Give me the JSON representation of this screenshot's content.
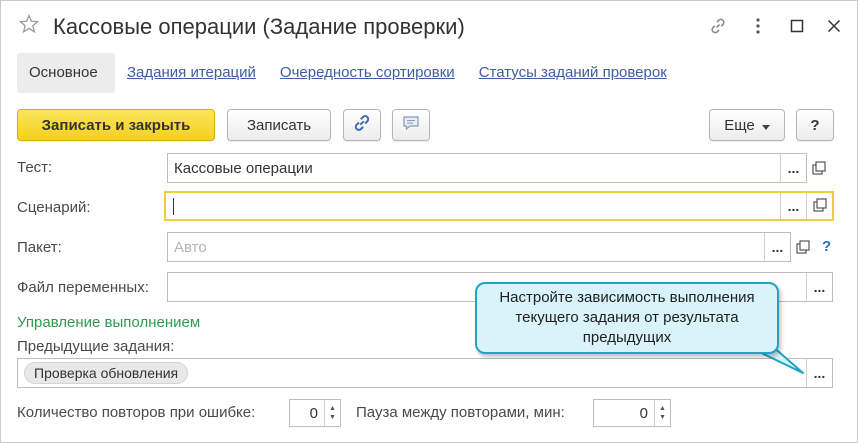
{
  "window": {
    "title": "Кассовые операции (Задание проверки)"
  },
  "tabs": [
    {
      "label": "Основное",
      "active": true
    },
    {
      "label": "Задания итераций"
    },
    {
      "label": "Очередность сортировки"
    },
    {
      "label": "Статусы заданий проверок"
    }
  ],
  "toolbar": {
    "save_close_label": "Записать и закрыть",
    "save_label": "Записать",
    "more_label": "Еще",
    "help_label": "?"
  },
  "form": {
    "test": {
      "label": "Тест:",
      "value": "Кассовые операции"
    },
    "scenario": {
      "label": "Сценарий:",
      "value": ""
    },
    "package": {
      "label": "Пакет:",
      "placeholder": "Авто"
    },
    "vars_file": {
      "label": "Файл переменных:",
      "value": ""
    },
    "section_title": "Управление выполнением",
    "prev_tasks_label": "Предыдущие задания:",
    "prev_tasks": [
      "Проверка обновления"
    ],
    "retry_label": "Количество повторов при ошибке:",
    "retry_value": "0",
    "pause_label": "Пауза между повторами, мин:",
    "pause_value": "0",
    "select_button": "...",
    "help_mark": "?"
  },
  "callout": {
    "text": "Настройте зависимость выполнения текущего задания от результата предыдущих"
  },
  "colors": {
    "accent_yellow": "#f5cf1c",
    "link_blue": "#3d5f9e",
    "section_green": "#2e9b4e",
    "callout_fill": "#d9f3fa",
    "callout_border": "#23a3c4"
  }
}
